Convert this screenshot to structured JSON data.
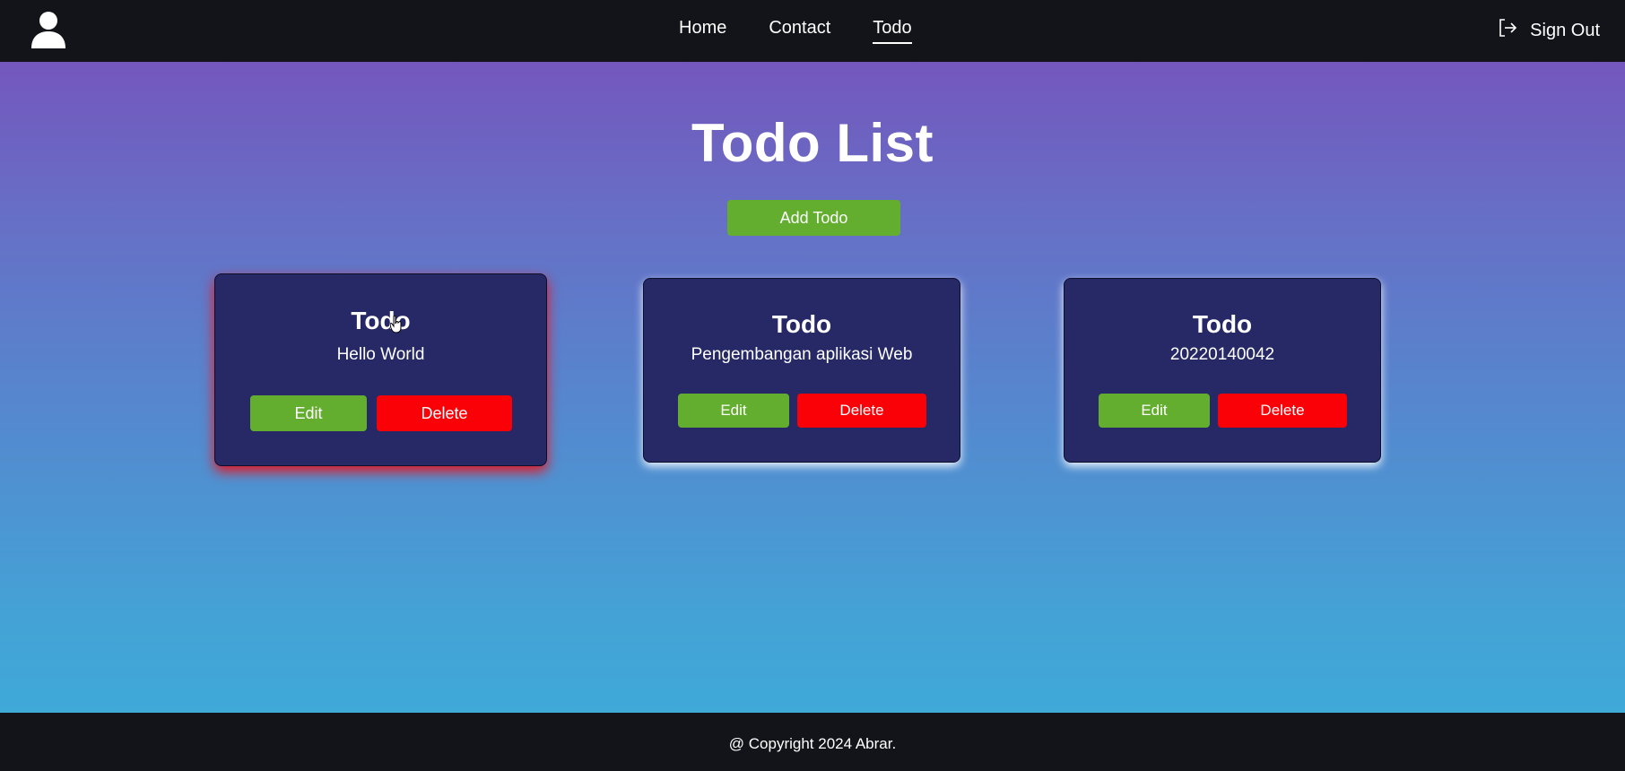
{
  "navbar": {
    "avatar_icon": "user-icon",
    "links": [
      {
        "label": "Home",
        "active": false
      },
      {
        "label": "Contact",
        "active": false
      },
      {
        "label": "Todo",
        "active": true
      }
    ],
    "signout_label": "Sign Out",
    "signout_icon": "sign-out-icon"
  },
  "main": {
    "title": "Todo List",
    "add_button_label": "Add Todo",
    "todos": [
      {
        "title": "Todo",
        "text": "Hello World",
        "edit_label": "Edit",
        "delete_label": "Delete"
      },
      {
        "title": "Todo",
        "text": "Pengembangan aplikasi Web",
        "edit_label": "Edit",
        "delete_label": "Delete"
      },
      {
        "title": "Todo",
        "text": "20220140042",
        "edit_label": "Edit",
        "delete_label": "Delete"
      }
    ]
  },
  "footer": {
    "text": "@ Copyright 2024 Abrar."
  },
  "colors": {
    "nav_bg": "#131419",
    "card_bg": "#272967",
    "edit_green": "#63ae2e",
    "delete_red": "#fa0007",
    "gradient_top": "#7457bd",
    "gradient_bottom": "#3fa9d8"
  }
}
